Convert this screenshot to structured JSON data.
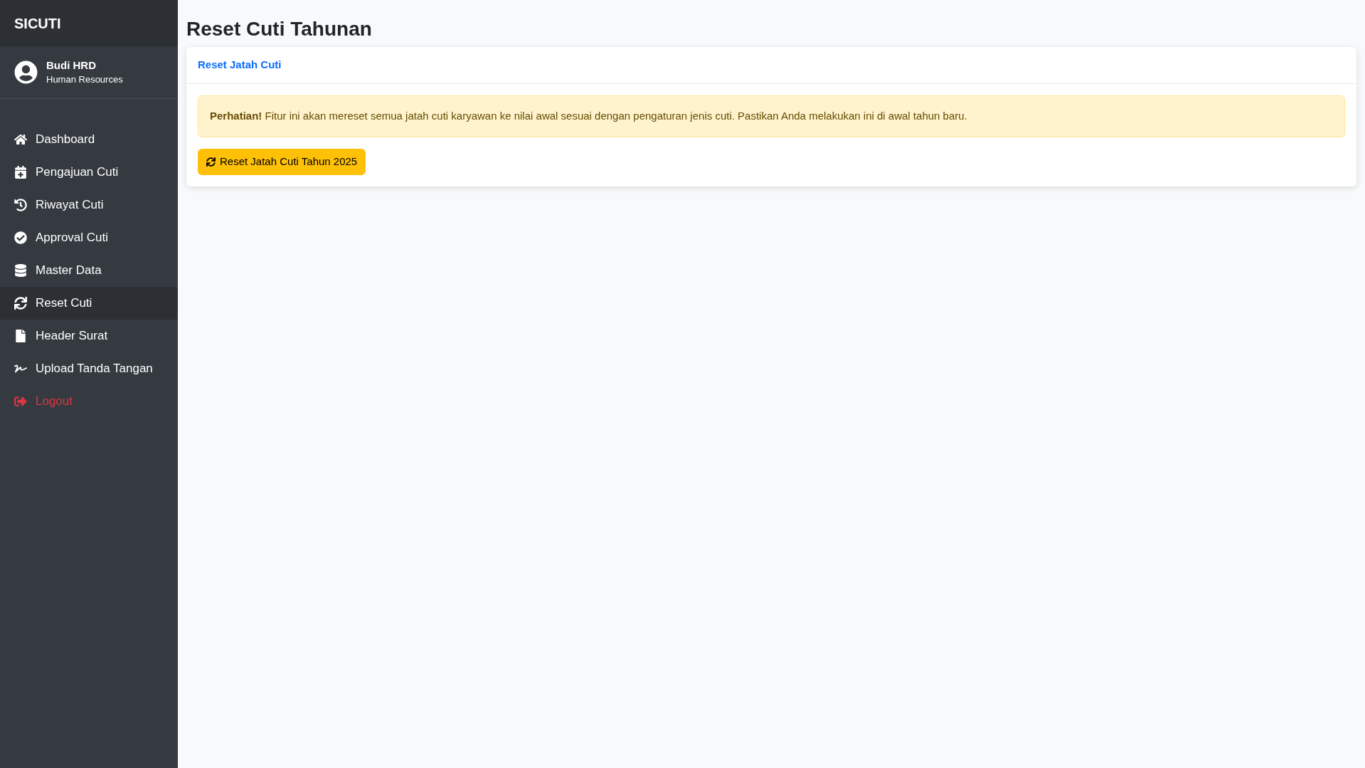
{
  "sidebar": {
    "brand": "SICUTI",
    "user": {
      "name": "Budi HRD",
      "role": "Human Resources"
    },
    "items": [
      {
        "label": "Dashboard",
        "selected": false,
        "kind": "link"
      },
      {
        "label": "Pengajuan Cuti",
        "selected": false,
        "kind": "link"
      },
      {
        "label": "Riwayat Cuti",
        "selected": false,
        "kind": "link"
      },
      {
        "label": "Approval Cuti",
        "selected": false,
        "kind": "link"
      },
      {
        "label": "Master Data",
        "selected": false,
        "kind": "link"
      },
      {
        "label": "Reset Cuti",
        "selected": true,
        "kind": "link"
      },
      {
        "label": "Header Surat",
        "selected": false,
        "kind": "link"
      },
      {
        "label": "Upload Tanda Tangan",
        "selected": false,
        "kind": "link"
      },
      {
        "label": "Logout",
        "selected": false,
        "kind": "danger"
      }
    ]
  },
  "page": {
    "title": "Reset Cuti Tahunan",
    "card": {
      "header": "Reset Jatah Cuti",
      "alert": "**Perhatian!** Fitur ini akan mereset semua jatah cuti karyawan ke nilai awal sesuai dengan pengaturan jenis cuti. Pastikan Anda melakukan ini di awal tahun baru.",
      "button": "Reset Jatah Cuti Tahun 2025"
    }
  }
}
